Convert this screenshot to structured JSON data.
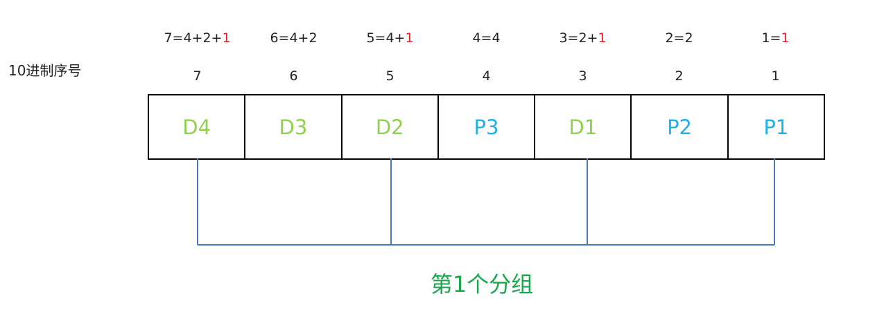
{
  "row_label": "10进制序号",
  "colors": {
    "data_bit": "#92d050",
    "parity_bit": "#1fb2e8",
    "highlight": "#e8202a",
    "group_line": "#4a78c0",
    "group_label": "#1aa84e"
  },
  "columns": [
    {
      "formula_prefix": "7=4+2+",
      "formula_highlight": "1",
      "index": "7",
      "bit": "D4",
      "bit_type": "data"
    },
    {
      "formula_prefix": "6=4+2",
      "formula_highlight": "",
      "index": "6",
      "bit": "D3",
      "bit_type": "data"
    },
    {
      "formula_prefix": "5=4+",
      "formula_highlight": "1",
      "index": "5",
      "bit": "D2",
      "bit_type": "data"
    },
    {
      "formula_prefix": "4=4",
      "formula_highlight": "",
      "index": "4",
      "bit": "P3",
      "bit_type": "parity"
    },
    {
      "formula_prefix": "3=2+",
      "formula_highlight": "1",
      "index": "3",
      "bit": "D1",
      "bit_type": "data"
    },
    {
      "formula_prefix": "2=2",
      "formula_highlight": "",
      "index": "2",
      "bit": "P2",
      "bit_type": "parity"
    },
    {
      "formula_prefix": "1=",
      "formula_highlight": "1",
      "index": "1",
      "bit": "P1",
      "bit_type": "parity"
    }
  ],
  "group": {
    "label": "第1个分组",
    "members": [
      "7",
      "5",
      "3",
      "1"
    ]
  }
}
